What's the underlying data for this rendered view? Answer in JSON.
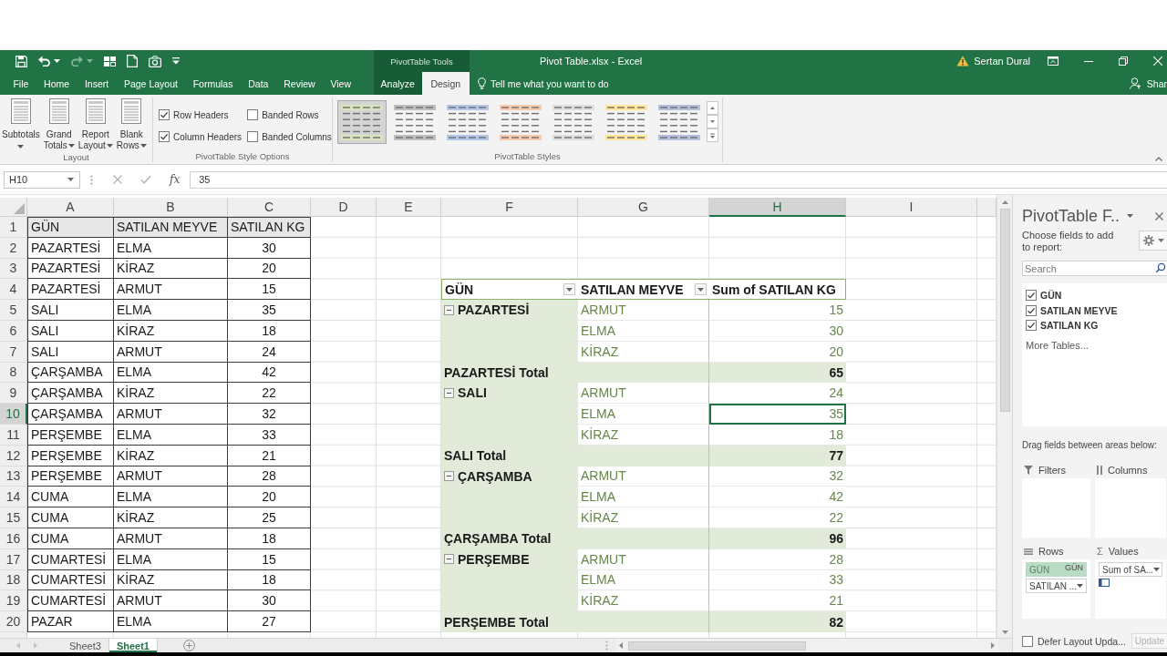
{
  "quick_access": [
    {
      "kind": "save",
      "disabled": false
    },
    {
      "kind": "undo",
      "disabled": false
    },
    {
      "kind": "redo",
      "disabled": true
    },
    {
      "kind": "form",
      "disabled": false
    },
    {
      "kind": "new",
      "disabled": false
    },
    {
      "kind": "camera",
      "disabled": false
    },
    {
      "kind": "customize",
      "disabled": false
    }
  ],
  "window": {
    "contextual_group": "PivotTable Tools",
    "title": "Pivot Table.xlsx - Excel",
    "user": "Sertan Dural"
  },
  "tabs": [
    {
      "label": "File",
      "selected": false,
      "contextual": false
    },
    {
      "label": "Home",
      "selected": false,
      "contextual": false
    },
    {
      "label": "Insert",
      "selected": false,
      "contextual": false
    },
    {
      "label": "Page Layout",
      "selected": false,
      "contextual": false
    },
    {
      "label": "Formulas",
      "selected": false,
      "contextual": false
    },
    {
      "label": "Data",
      "selected": false,
      "contextual": false
    },
    {
      "label": "Review",
      "selected": false,
      "contextual": false
    },
    {
      "label": "View",
      "selected": false,
      "contextual": false
    },
    {
      "label": "Analyze",
      "selected": false,
      "contextual": true
    },
    {
      "label": "Design",
      "selected": true,
      "contextual": true
    }
  ],
  "tell_me": "Tell me what you want to do",
  "share": "Shar",
  "ribbon": {
    "groups": [
      {
        "kind": "buttons",
        "label": "Layout",
        "buttons": [
          {
            "label": "Subtotals"
          },
          {
            "label": "Grand Totals"
          },
          {
            "label": "Report Layout"
          },
          {
            "label": "Blank Rows"
          }
        ]
      },
      {
        "kind": "checkboxes",
        "label": "PivotTable Style Options",
        "options": [
          {
            "label": "Row Headers",
            "checked": true
          },
          {
            "label": "Banded Rows",
            "checked": false
          },
          {
            "label": "Column Headers",
            "checked": true
          },
          {
            "label": "Banded Columns",
            "checked": false
          }
        ]
      },
      {
        "kind": "gallery",
        "label": "PivotTable Styles",
        "styles": [
          {
            "color": "#d7e4bc",
            "selected": true
          },
          {
            "color": "#bfbfbf",
            "selected": false
          },
          {
            "color": "#b4c6e7",
            "selected": false
          },
          {
            "color": "#f8cbad",
            "selected": false
          },
          {
            "color": "#dedede",
            "selected": false
          },
          {
            "color": "#ffe699",
            "selected": false
          },
          {
            "color": "#b4c0dd",
            "selected": false
          }
        ]
      }
    ]
  },
  "formula_bar": {
    "name_box": "H10",
    "function_label": "fx",
    "value": "35"
  },
  "sheet": {
    "columns": [
      {
        "label": "A",
        "selected": false
      },
      {
        "label": "B",
        "selected": false
      },
      {
        "label": "C",
        "selected": false
      },
      {
        "label": "D",
        "selected": false
      },
      {
        "label": "E",
        "selected": false
      },
      {
        "label": "F",
        "selected": false
      },
      {
        "label": "G",
        "selected": false
      },
      {
        "label": "H",
        "selected": true
      },
      {
        "label": "I",
        "selected": false
      }
    ],
    "rows": [
      {
        "label": "1",
        "selected": false
      },
      {
        "label": "2",
        "selected": false
      },
      {
        "label": "3",
        "selected": false
      },
      {
        "label": "4",
        "selected": false
      },
      {
        "label": "5",
        "selected": false
      },
      {
        "label": "6",
        "selected": false
      },
      {
        "label": "7",
        "selected": false
      },
      {
        "label": "8",
        "selected": false
      },
      {
        "label": "9",
        "selected": false
      },
      {
        "label": "10",
        "selected": true
      },
      {
        "label": "11",
        "selected": false
      },
      {
        "label": "12",
        "selected": false
      },
      {
        "label": "13",
        "selected": false
      },
      {
        "label": "14",
        "selected": false
      },
      {
        "label": "15",
        "selected": false
      },
      {
        "label": "16",
        "selected": false
      },
      {
        "label": "17",
        "selected": false
      },
      {
        "label": "18",
        "selected": false
      },
      {
        "label": "19",
        "selected": false
      },
      {
        "label": "20",
        "selected": false
      }
    ],
    "source_table": {
      "columns": [
        "GÜN",
        "SATILAN MEYVE",
        "SATILAN KG"
      ],
      "rows": [
        [
          "PAZARTESİ",
          "ELMA",
          "30"
        ],
        [
          "PAZARTESİ",
          "KİRAZ",
          "20"
        ],
        [
          "PAZARTESİ",
          "ARMUT",
          "15"
        ],
        [
          "SALI",
          "ELMA",
          "35"
        ],
        [
          "SALI",
          "KİRAZ",
          "18"
        ],
        [
          "SALI",
          "ARMUT",
          "24"
        ],
        [
          "ÇARŞAMBA",
          "ELMA",
          "42"
        ],
        [
          "ÇARŞAMBA",
          "KİRAZ",
          "22"
        ],
        [
          "ÇARŞAMBA",
          "ARMUT",
          "32"
        ],
        [
          "PERŞEMBE",
          "ELMA",
          "33"
        ],
        [
          "PERŞEMBE",
          "KİRAZ",
          "21"
        ],
        [
          "PERŞEMBE",
          "ARMUT",
          "28"
        ],
        [
          "CUMA",
          "ELMA",
          "20"
        ],
        [
          "CUMA",
          "KİRAZ",
          "25"
        ],
        [
          "CUMA",
          "ARMUT",
          "18"
        ],
        [
          "CUMARTESİ",
          "ELMA",
          "15"
        ],
        [
          "CUMARTESİ",
          "KİRAZ",
          "18"
        ],
        [
          "CUMARTESİ",
          "ARMUT",
          "30"
        ],
        [
          "PAZAR",
          "ELMA",
          "27"
        ]
      ]
    },
    "pivot": {
      "headers": [
        {
          "label": "GÜN",
          "filter": true
        },
        {
          "label": "SATILAN MEYVE",
          "filter": true
        },
        {
          "label": "Sum of SATILAN KG",
          "filter": false
        }
      ],
      "groups": [
        {
          "label": "PAZARTESİ",
          "expanded": true,
          "items": [
            {
              "label": "ARMUT",
              "value": "15",
              "selected": false
            },
            {
              "label": "ELMA",
              "value": "30",
              "selected": false
            },
            {
              "label": "KİRAZ",
              "value": "20",
              "selected": false
            }
          ],
          "total_label": "PAZARTESİ Total",
          "total": "65"
        },
        {
          "label": "SALI",
          "expanded": true,
          "items": [
            {
              "label": "ARMUT",
              "value": "24",
              "selected": false
            },
            {
              "label": "ELMA",
              "value": "35",
              "selected": true
            },
            {
              "label": "KİRAZ",
              "value": "18",
              "selected": false
            }
          ],
          "total_label": "SALI Total",
          "total": "77"
        },
        {
          "label": "ÇARŞAMBA",
          "expanded": true,
          "items": [
            {
              "label": "ARMUT",
              "value": "32",
              "selected": false
            },
            {
              "label": "ELMA",
              "value": "42",
              "selected": false
            },
            {
              "label": "KİRAZ",
              "value": "22",
              "selected": false
            }
          ],
          "total_label": "ÇARŞAMBA Total",
          "total": "96"
        },
        {
          "label": "PERŞEMBE",
          "expanded": true,
          "items": [
            {
              "label": "ARMUT",
              "value": "28",
              "selected": false
            },
            {
              "label": "ELMA",
              "value": "33",
              "selected": false
            },
            {
              "label": "KİRAZ",
              "value": "21",
              "selected": false
            }
          ],
          "total_label": "PERŞEMBE Total",
          "total": "82"
        }
      ]
    }
  },
  "sheet_tabs": [
    {
      "label": "Sheet3",
      "selected": false
    },
    {
      "label": "Sheet1",
      "selected": true
    }
  ],
  "field_pane": {
    "title": "PivotTable F..",
    "instruction": "Choose fields to add to report:",
    "search": {
      "placeholder": "Search"
    },
    "fields": [
      {
        "label": "GÜN",
        "checked": true
      },
      {
        "label": "SATILAN MEYVE",
        "checked": true
      },
      {
        "label": "SATILAN KG",
        "checked": true
      }
    ],
    "more_tables": "More Tables...",
    "areas_hint": "Drag fields between areas below:",
    "areas": [
      {
        "kind": "filters",
        "label": "Filters"
      },
      {
        "kind": "columns",
        "label": "Columns"
      },
      {
        "kind": "rows",
        "label": "Rows",
        "items": [
          {
            "label": "GÜN",
            "dragging": true
          },
          {
            "label": "SATILAN ...",
            "dragging": false
          }
        ]
      },
      {
        "kind": "values",
        "label": "Values",
        "symbol": "Σ",
        "items": [
          {
            "label": "Sum of SA...",
            "dragging": false
          }
        ]
      }
    ],
    "drag_label": "GÜN",
    "defer_update": {
      "label": "Defer Layout Upda...",
      "checked": false
    },
    "update_button": {
      "label": "Update",
      "disabled": true
    }
  }
}
